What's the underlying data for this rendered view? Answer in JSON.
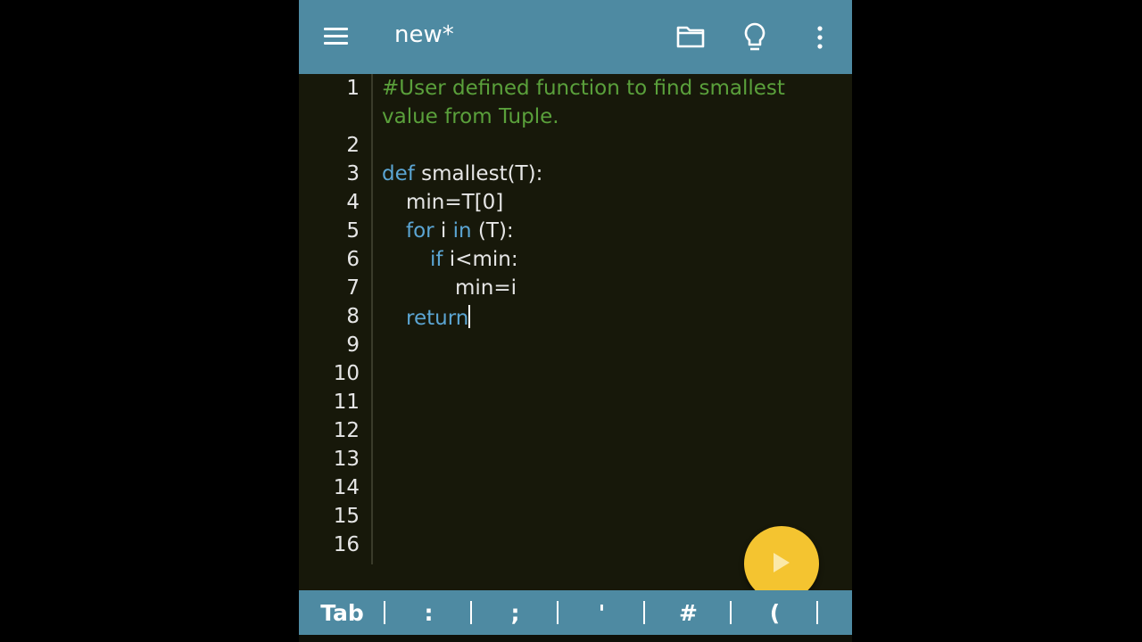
{
  "appbar": {
    "title": "new*",
    "icons": [
      "menu-icon",
      "folder-icon",
      "lightbulb-icon",
      "more-vert-icon"
    ]
  },
  "editor": {
    "line_numbers": [
      "1",
      "2",
      "3",
      "4",
      "5",
      "6",
      "7",
      "8",
      "9",
      "10",
      "11",
      "12",
      "13",
      "14",
      "15",
      "16"
    ],
    "lines": {
      "l1a": "#User defined function to find smallest",
      "l1b": "value from Tuple.",
      "l3_kw": "def",
      "l3_rest": " smallest(T):",
      "l4": "min=T[0]",
      "l5_kw1": "for",
      "l5_mid": " i ",
      "l5_kw2": "in",
      "l5_rest": " (T):",
      "l6_kw": "if",
      "l6_rest": " i<min:",
      "l7": "min=i",
      "l8_kw": "return"
    }
  },
  "fab": {
    "icon": "play-icon"
  },
  "keybar": {
    "keys": [
      "Tab",
      ":",
      ";",
      "'",
      "#",
      "("
    ]
  },
  "colors": {
    "appbar": "#4e8aa2",
    "editor_bg": "#17180a",
    "comment": "#5aa03b",
    "keyword": "#5ba5d3",
    "fab": "#f4c430"
  }
}
